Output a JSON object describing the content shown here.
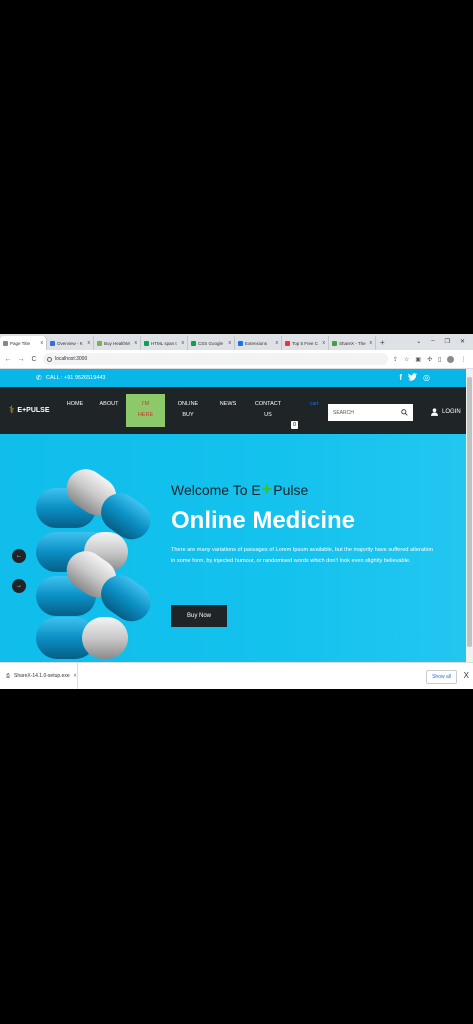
{
  "browser": {
    "tabs": [
      {
        "title": "Page Title",
        "color": "#888888",
        "active": true
      },
      {
        "title": "Overview - K",
        "color": "#3b6fd6"
      },
      {
        "title": "Buy HealthM",
        "color": "#7cb342"
      },
      {
        "title": "HTML span t",
        "color": "#0f9d58"
      },
      {
        "title": "CSS Google",
        "color": "#0f9d58"
      },
      {
        "title": "Extensions",
        "color": "#1a73e8"
      },
      {
        "title": "Top 5 Free C",
        "color": "#e53935"
      },
      {
        "title": "ShareX - The",
        "color": "#43a047"
      }
    ],
    "tab_close": "x",
    "new_tab": "+",
    "window_controls": [
      "⌄",
      "–",
      "❐",
      "✕"
    ],
    "url": "localhost:3000",
    "nav_buttons": [
      "←",
      "→",
      "C"
    ]
  },
  "site": {
    "topbar": {
      "phone_text": "CALL : +91 9526519443",
      "social": [
        "f",
        "t",
        "◎"
      ]
    },
    "logo": {
      "text": "E+PULSE"
    },
    "nav": [
      {
        "label": "HOME",
        "highlight": false
      },
      {
        "label": "ABOUT",
        "highlight": false
      },
      {
        "label": "I'M HERE",
        "highlight": true
      },
      {
        "label": "ONLINE BUY",
        "highlight": false
      },
      {
        "label": "NEWS",
        "highlight": false
      },
      {
        "label": "CONTACT US",
        "highlight": false
      }
    ],
    "cart_label": "cart",
    "cart_count": "0",
    "search_placeholder": "SEARCH",
    "login_label": "LOGIN",
    "hero": {
      "welcome_pre": "Welcome To E",
      "welcome_plus": "+",
      "welcome_post": "Pulse",
      "headline": "Online Medicine",
      "description": "There are many variations of passages of Lorem Ipsum available, but the majority have suffered alteration in some form, by injected humour, or randomised words which don't look even slightly believable.",
      "button": "Buy Now",
      "prev_arrow": "←",
      "next_arrow": "→"
    }
  },
  "downloads": {
    "file": "ShareX-14.1.0-setup.exe",
    "show_all": "Show all",
    "close": "X"
  },
  "colors": {
    "accent": "#08b7e8",
    "dark": "#1f2427",
    "highlight": "#8cc96b",
    "plus": "#3fbf2b"
  }
}
